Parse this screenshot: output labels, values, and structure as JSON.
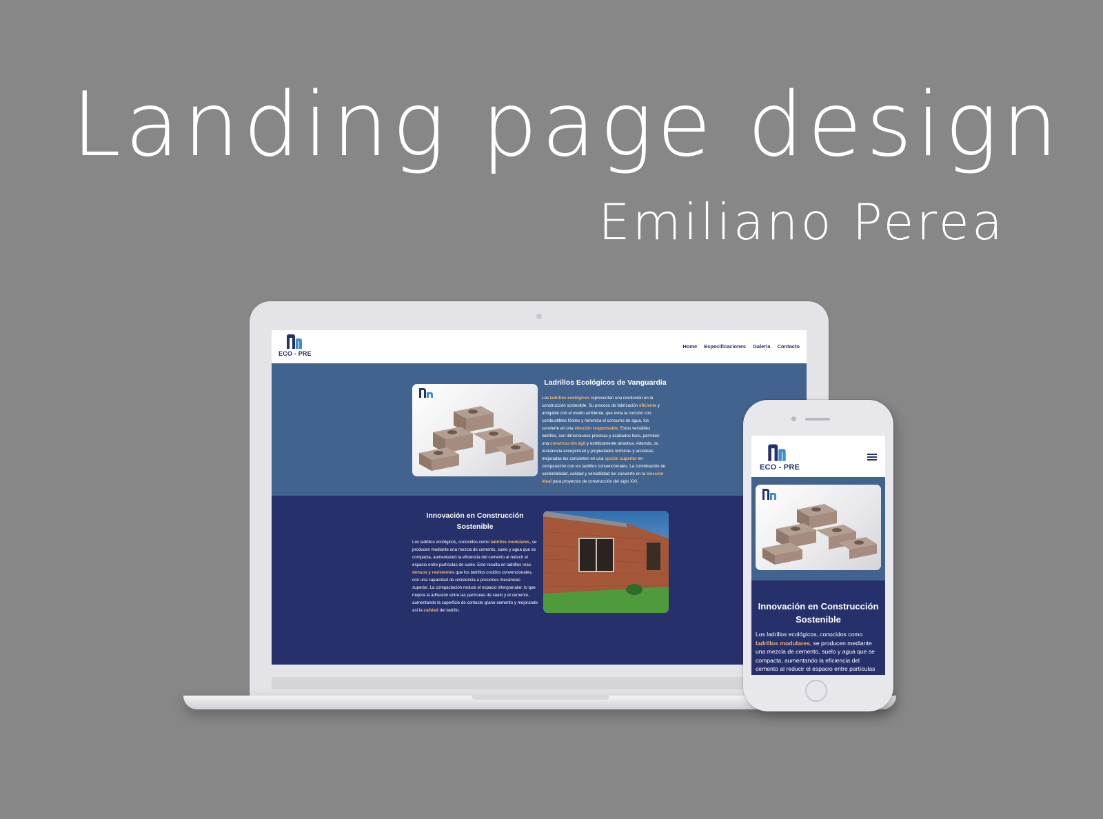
{
  "heading": "Landing page design",
  "author": "Emiliano Perea",
  "brand": {
    "logo_text": "ECO - PRE",
    "primary": "#24306d",
    "section_blue": "#43638f",
    "section_navy": "#26306b",
    "highlight": "#f0b870"
  },
  "nav": {
    "items": [
      "Home",
      "Especificaciones",
      "Galeria",
      "Contacto"
    ]
  },
  "section1": {
    "title": "Ladrillos Ecológicos de Vanguardia",
    "body": [
      {
        "t": "Los "
      },
      {
        "t": "ladrillos ecológicos",
        "hl": true
      },
      {
        "t": " representan una revolución en la construcción sostenible. Su proceso de fabricación "
      },
      {
        "t": "eficiente",
        "hl": true
      },
      {
        "t": " y amigable con el medio ambiente, que evita la cocción con combustibles fósiles y minimiza el consumo de agua, los convierte en una "
      },
      {
        "t": "elección responsable",
        "hl": true
      },
      {
        "t": ". Estos versátiles ladrillos, con dimensiones precisas y acabados lisos, permiten una "
      },
      {
        "t": "construcción ágil",
        "hl": true
      },
      {
        "t": " y estéticamente atractiva. Además, su resistencia excepcional y propiedades térmicas y acústicas mejoradas los convierten en una "
      },
      {
        "t": "opción superior",
        "hl": true
      },
      {
        "t": " en comparación con los ladrillos convencionales. La combinación de sostenibilidad, calidad y versatilidad los convierte en la "
      },
      {
        "t": "elección ideal",
        "hl": true
      },
      {
        "t": " para proyectos de construcción del siglo XXI."
      }
    ]
  },
  "section2": {
    "title": "Innovación en Construcción Sostenible",
    "body": [
      {
        "t": "Los ladrillos ecológicos, conocidos como "
      },
      {
        "t": "ladrillos modulares",
        "hl": true
      },
      {
        "t": ", se producen mediante una mezcla de cemento, suelo y agua que se compacta, aumentando la eficiencia del cemento al reducir el espacio entre partículas de suelo. Esto resulta en ladrillos "
      },
      {
        "t": "más densos y resistentes",
        "hl": true
      },
      {
        "t": " que los ladrillos cocidos convencionales, con una capacidad de resistencia a presiones mecánicas superior. La compactación reduce el espacio intergranular, lo que mejora la adhesión entre las partículas de suelo y el cemento, aumentando la superficie de contacto grano-cemento y mejorando así la "
      },
      {
        "t": "calidad",
        "hl": true
      },
      {
        "t": " del ladrillo."
      }
    ]
  },
  "mobile": {
    "title": "Innovación en Construcción Sostenible",
    "body": [
      {
        "t": "Los ladrillos ecológicos, conocidos como "
      },
      {
        "t": "ladrillos modulares",
        "hl": true
      },
      {
        "t": ", se producen mediante una mezcla de cemento, suelo y agua que se compacta, aumentando la eficiencia del cemento al reducir el espacio entre partículas de suelo. Esto resulta en"
      }
    ]
  },
  "icons": {
    "menu": "hamburger-icon",
    "logo": "eco-pre-logo-icon"
  }
}
